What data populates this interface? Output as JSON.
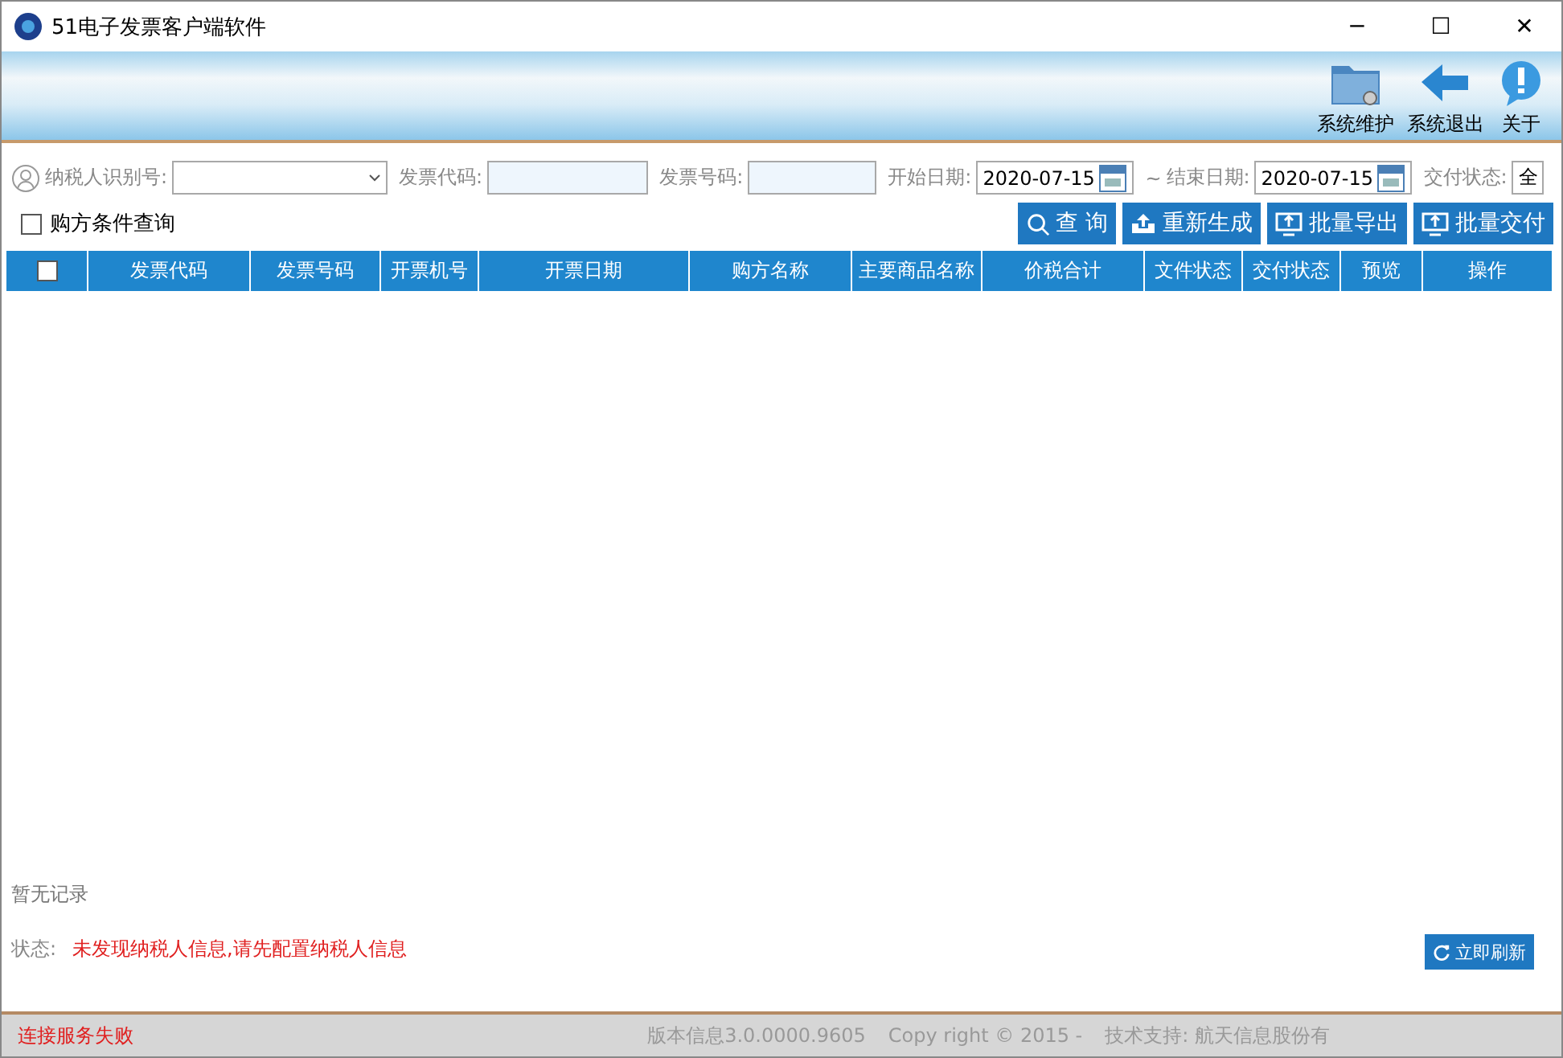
{
  "window": {
    "title": "51电子发票客户端软件",
    "controls": [
      "─",
      "☐",
      "✕"
    ]
  },
  "toolbar": [
    {
      "kind": "maintenance",
      "label": "系统维护"
    },
    {
      "kind": "exit",
      "label": "系统退出"
    },
    {
      "kind": "about",
      "label": "关于"
    }
  ],
  "filters": {
    "taxpayer_id": {
      "label": "纳税人识别号:"
    },
    "invoice_code": {
      "label": "发票代码:"
    },
    "invoice_number": {
      "label": "发票号码:"
    },
    "start_date": {
      "label": "开始日期:",
      "value": "2020-07-15"
    },
    "separator": "~",
    "end_date": {
      "label": "结束日期:",
      "value": "2020-07-15"
    },
    "delivery_status": {
      "label": "交付状态:",
      "value": "全"
    }
  },
  "buyer_query": {
    "label": "购方条件查询",
    "checked": false
  },
  "actions": [
    {
      "kind": "search",
      "label": "查 询"
    },
    {
      "kind": "regenerate",
      "label": "重新生成"
    },
    {
      "kind": "export",
      "label": "批量导出"
    },
    {
      "kind": "export",
      "label": "批量交付"
    }
  ],
  "table": {
    "select_all": false,
    "columns": [
      "发票代码",
      "发票号码",
      "开票机号",
      "开票日期",
      "购方名称",
      "主要商品名称",
      "价税合计",
      "文件状态",
      "交付状态",
      "预览",
      "操作"
    ]
  },
  "empty_text": "暂无记录",
  "status": {
    "label": "状态:",
    "message": "未发现纳税人信息,请先配置纳税人信息"
  },
  "refresh_button": "立即刷新",
  "status_bar": {
    "connection": "连接服务失败",
    "version": "版本信息3.0.0000.9605",
    "copyright": "Copy right © 2015 -",
    "support": "技术支持: 航天信息股份有"
  }
}
